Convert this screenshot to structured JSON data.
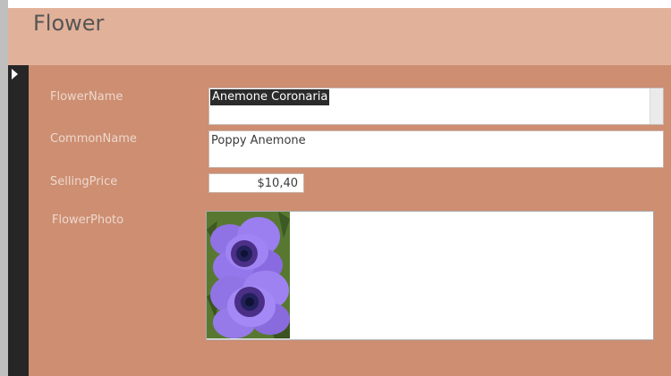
{
  "form": {
    "title": "Flower"
  },
  "fields": {
    "flower_name": {
      "label": "FlowerName",
      "value": "Anemone Coronaria"
    },
    "common_name": {
      "label": "CommonName",
      "value": "Poppy Anemone"
    },
    "selling_price": {
      "label": "SellingPrice",
      "value": "$10,40"
    },
    "flower_photo": {
      "label": "FlowerPhoto"
    }
  },
  "colors": {
    "header_bg": "#e2b19a",
    "detail_bg": "#cd8e72",
    "record_selector_bg": "#262626",
    "label_text": "#eed8cc",
    "selection_bg": "#2b2b2b"
  },
  "icons": {
    "record_selector": "current-record-arrow-icon"
  }
}
